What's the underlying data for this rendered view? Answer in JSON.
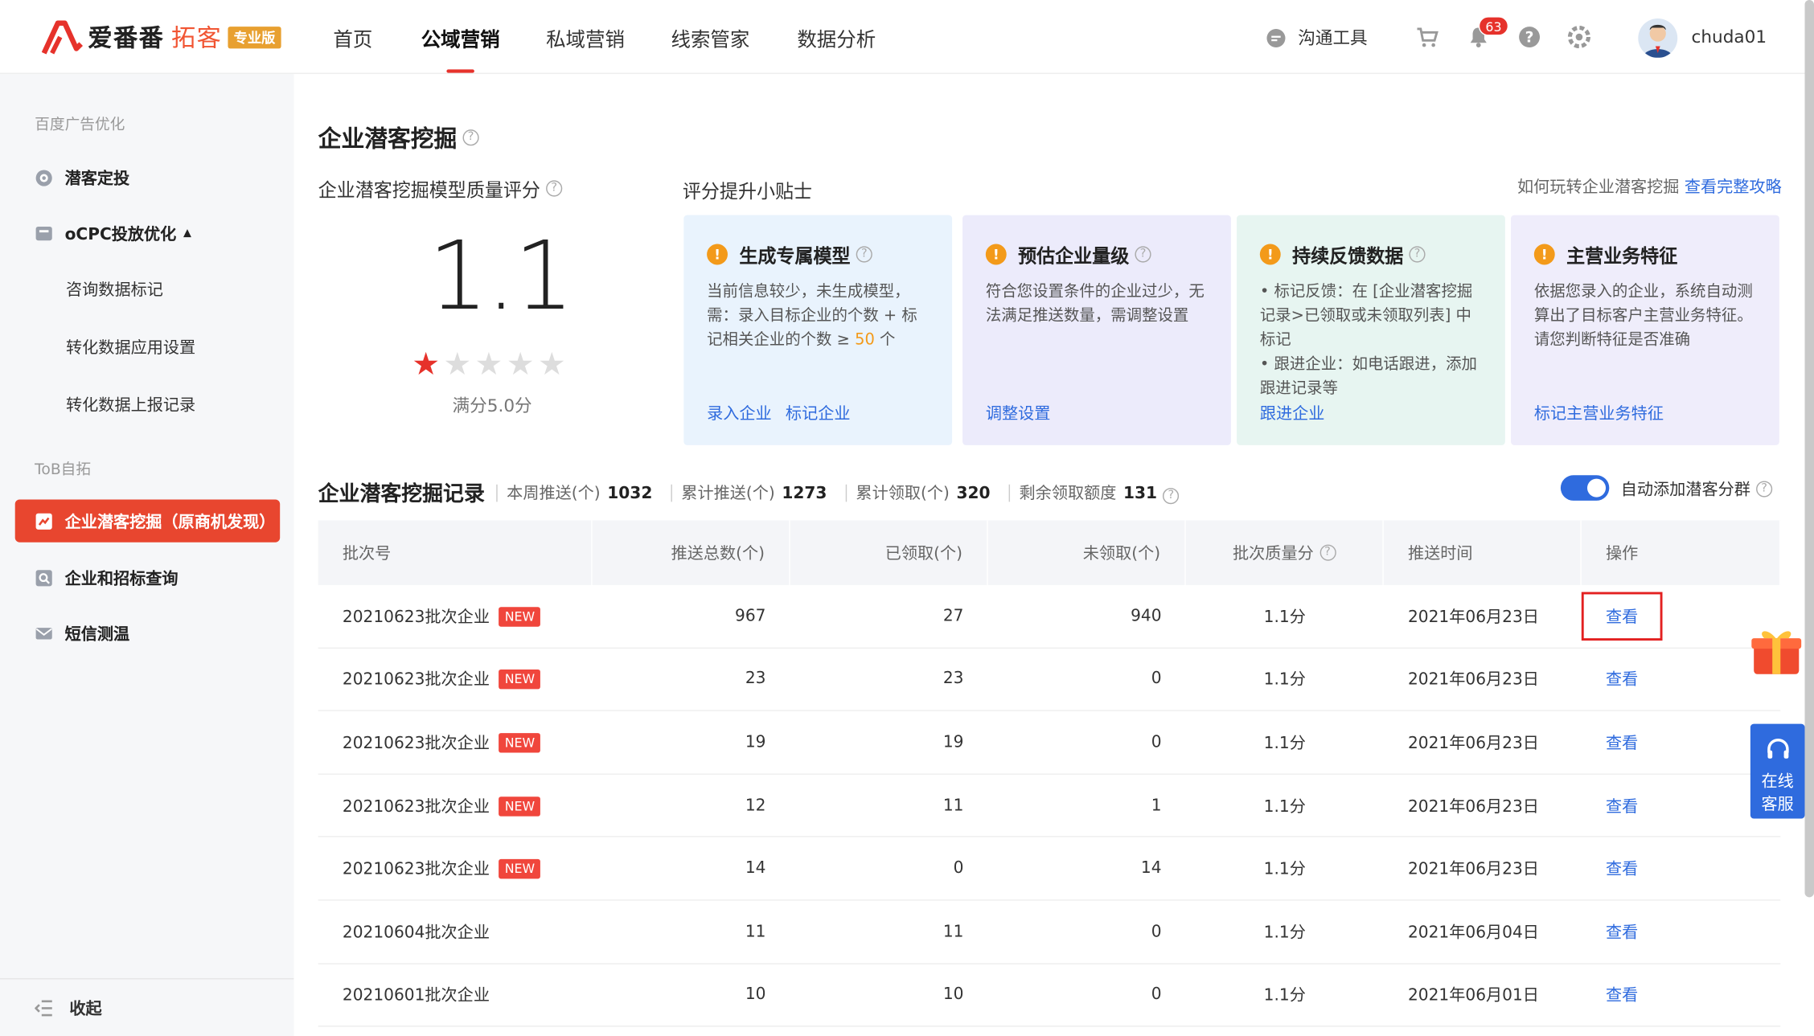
{
  "header": {
    "brand_name": "爱番番",
    "brand_sub": "拓客",
    "brand_badge": "专业版",
    "nav": [
      "首页",
      "公域营销",
      "私域营销",
      "线索管家",
      "数据分析"
    ],
    "tools_label": "沟通工具",
    "notif_count": "63",
    "username": "chuda01"
  },
  "sidebar": {
    "section1": "百度广告优化",
    "item_target": "潜客定投",
    "item_ocpc": "oCPC投放优化",
    "ocpc_subs": [
      "咨询数据标记",
      "转化数据应用设置",
      "转化数据上报记录"
    ],
    "section2": "ToB自拓",
    "item_active": "企业潜客挖掘（原商机发现）",
    "item_query": "企业和招标查询",
    "item_sms": "短信测温",
    "collapse": "收起"
  },
  "main": {
    "page_title": "企业潜客挖掘",
    "score_title": "企业潜客挖掘模型质量评分",
    "score_value": "1.1",
    "rating": 1,
    "rating_max": 5,
    "full_score": "满分5.0分",
    "tips_title": "评分提升小贴士",
    "guide_text": "如何玩转企业潜客挖掘",
    "guide_link": "查看完整攻略",
    "cards": [
      {
        "title": "生成专属模型",
        "body_a": "当前信息较少，未生成模型，需：录入目标企业的个数 + 标记相关企业的个数 ≥ ",
        "body_hl": "50",
        "body_b": " 个",
        "link1": "录入企业",
        "link2": "标记企业",
        "bg": "#e9f3fd"
      },
      {
        "title": "预估企业量级",
        "body_a": "符合您设置条件的企业过少，无法满足推送数量，需调整设置",
        "body_hl": "",
        "body_b": "",
        "link1": "调整设置",
        "link2": "",
        "bg": "#ecebfb"
      },
      {
        "title": "持续反馈数据",
        "body_a": "• 标记反馈：在 [企业潜客挖掘记录>已领取或未领取列表] 中标记",
        "body_b2": "• 跟进企业：如电话跟进，添加跟进记录等",
        "body_hl": "",
        "body_b": "",
        "link1": "跟进企业",
        "link2": "",
        "bg": "#e7f5f1"
      },
      {
        "title": "主营业务特征",
        "body_a": "依据您录入的企业，系统自动测算出了目标客户主营业务特征。请您判断特征是否准确",
        "body_hl": "",
        "body_b": "",
        "link1": "标记主营业务特征",
        "link2": "",
        "bg": "#efedfb"
      }
    ],
    "records_title": "企业潜客挖掘记录",
    "stats": [
      {
        "label": "本周推送(个)",
        "value": "1032"
      },
      {
        "label": "累计推送(个)",
        "value": "1273"
      },
      {
        "label": "累计领取(个)",
        "value": "320"
      },
      {
        "label": "剩余领取额度",
        "value": "131"
      }
    ],
    "auto_group_label": "自动添加潜客分群",
    "table": {
      "headers": [
        "批次号",
        "推送总数(个)",
        "已领取(个)",
        "未领取(个)",
        "批次质量分",
        "推送时间",
        "操作"
      ],
      "new_label": "NEW",
      "rows": [
        {
          "batch": "20210623批次企业",
          "is_new": true,
          "total": "967",
          "claimed": "27",
          "unclaimed": "940",
          "score": "1.1分",
          "time": "2021年06月23日",
          "action": "查看"
        },
        {
          "batch": "20210623批次企业",
          "is_new": true,
          "total": "23",
          "claimed": "23",
          "unclaimed": "0",
          "score": "1.1分",
          "time": "2021年06月23日",
          "action": "查看"
        },
        {
          "batch": "20210623批次企业",
          "is_new": true,
          "total": "19",
          "claimed": "19",
          "unclaimed": "0",
          "score": "1.1分",
          "time": "2021年06月23日",
          "action": "查看"
        },
        {
          "batch": "20210623批次企业",
          "is_new": true,
          "total": "12",
          "claimed": "11",
          "unclaimed": "1",
          "score": "1.1分",
          "time": "2021年06月23日",
          "action": "查看"
        },
        {
          "batch": "20210623批次企业",
          "is_new": true,
          "total": "14",
          "claimed": "0",
          "unclaimed": "14",
          "score": "1.1分",
          "time": "2021年06月23日",
          "action": "查看"
        },
        {
          "batch": "20210604批次企业",
          "is_new": false,
          "total": "11",
          "claimed": "11",
          "unclaimed": "0",
          "score": "1.1分",
          "time": "2021年06月04日",
          "action": "查看"
        },
        {
          "batch": "20210601批次企业",
          "is_new": false,
          "total": "10",
          "claimed": "10",
          "unclaimed": "0",
          "score": "1.1分",
          "time": "2021年06月01日",
          "action": "查看"
        }
      ]
    }
  },
  "float": {
    "service_label_1": "在线",
    "service_label_2": "客服"
  },
  "colors": {
    "accent": "#e8462f",
    "link": "#2f6bde",
    "brand_red": "#e6322b"
  }
}
